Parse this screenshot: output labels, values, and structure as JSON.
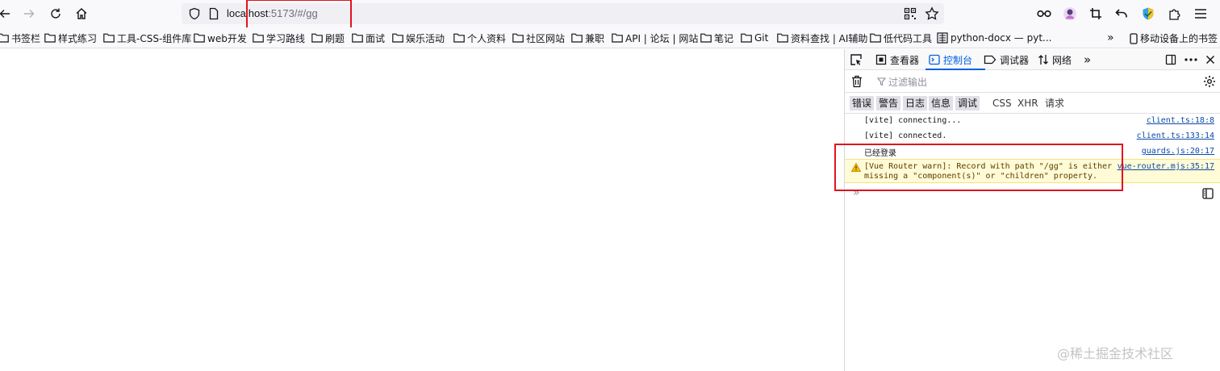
{
  "browser": {
    "url_host": "localhost",
    "url_rest": ":5173/#/gg"
  },
  "bookmarks": [
    "书签栏",
    "样式练习",
    "工具-CSS-组件库",
    "web开发",
    "学习路线",
    "刷题",
    "面试",
    "娱乐活动",
    "个人资料",
    "社区网站",
    "兼职",
    "API | 论坛 | 网站",
    "笔记",
    "Git",
    "资料查找 | AI辅助",
    "低代码工具",
    "python-docx — pyt..."
  ],
  "bookmarks_overflow": "»",
  "mobile_bookmarks": "移动设备上的书签",
  "devtools": {
    "tabs": [
      "查看器",
      "控制台",
      "调试器",
      "网络"
    ],
    "more_tabs": "»",
    "filter_placeholder": "过滤输出",
    "categories_on": [
      "错误",
      "警告",
      "日志",
      "信息",
      "调试"
    ],
    "categories_plain": [
      "CSS",
      "XHR",
      "请求"
    ],
    "logs": [
      {
        "text": "[vite] connecting...",
        "source": "client.ts:18:8",
        "level": "log"
      },
      {
        "text": "[vite] connected.",
        "source": "client.ts:133:14",
        "level": "log"
      },
      {
        "text": "已经登录",
        "source": "guards.js:20:17",
        "level": "log"
      },
      {
        "text": "[Vue Router warn]: Record with path \"/gg\" is either\nmissing a \"component(s)\" or \"children\" property.",
        "source": "vue-router.mjs:35:17",
        "level": "warn"
      }
    ],
    "prompt": "»"
  },
  "watermark": "@稀土掘金技术社区",
  "colors": {
    "accent": "#0060df",
    "highlight": "#e0141e",
    "warning_bg": "#fffbd6"
  }
}
